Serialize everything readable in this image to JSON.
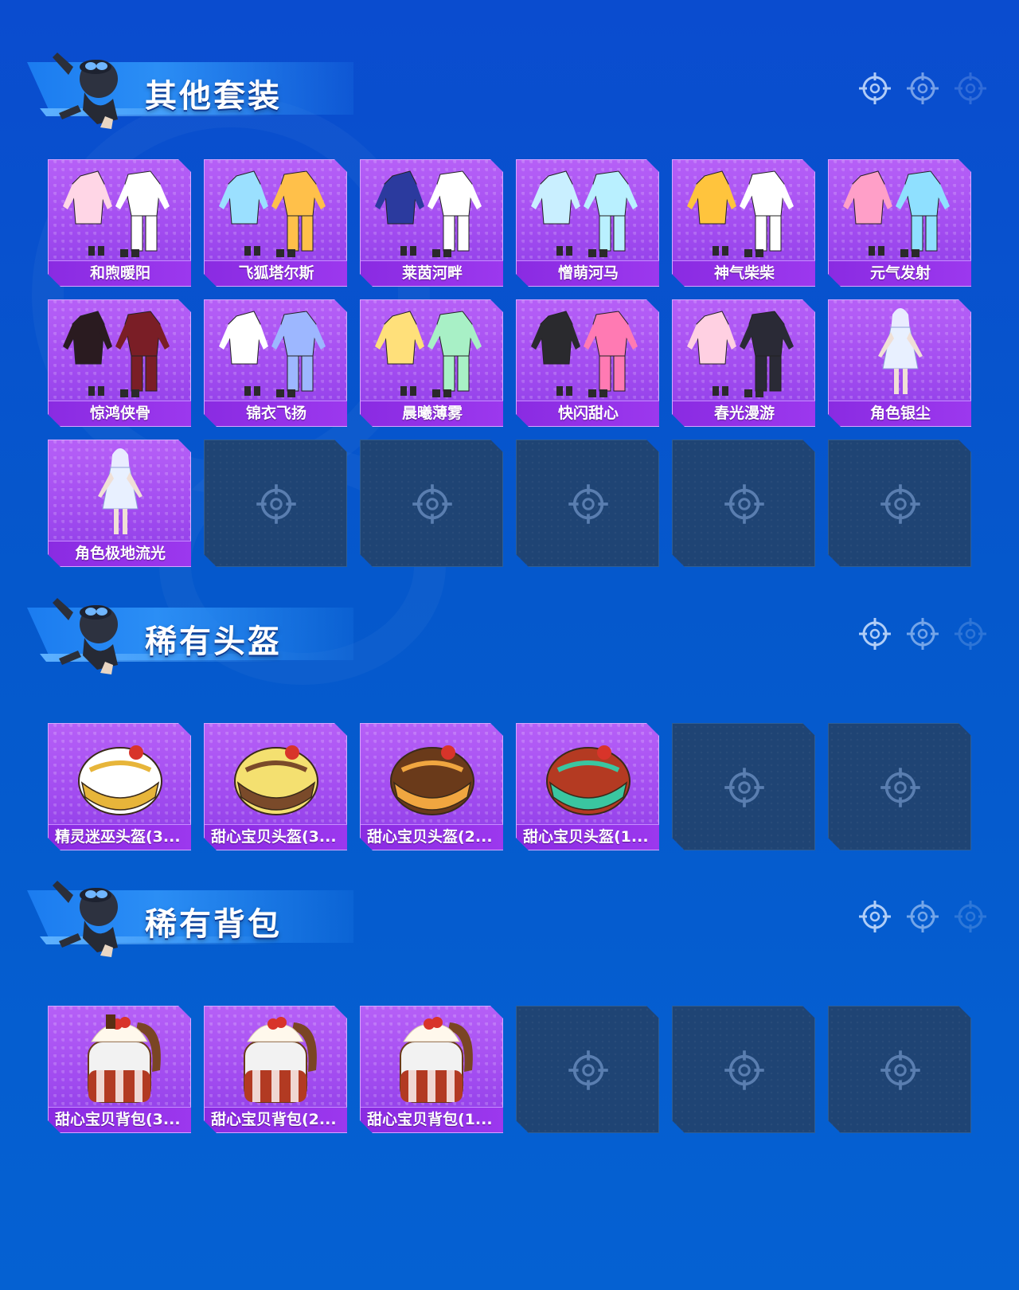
{
  "colors": {
    "background": "#0558cc",
    "card_purple": "#a24cf0",
    "card_label": "#8a2be2",
    "card_empty": "#1f4474",
    "banner": "#2b8ef5"
  },
  "sections": [
    {
      "title": "其他套装",
      "items": [
        {
          "name": "和煦暖阳",
          "icon": "outfit-icon"
        },
        {
          "name": "飞狐塔尔斯",
          "icon": "outfit-icon"
        },
        {
          "name": "莱茵河畔",
          "icon": "outfit-icon"
        },
        {
          "name": "憎萌河马",
          "icon": "outfit-icon"
        },
        {
          "name": "神气柴柴",
          "icon": "outfit-icon"
        },
        {
          "name": "元气发射",
          "icon": "outfit-icon"
        },
        {
          "name": "惊鸿侠骨",
          "icon": "outfit-icon"
        },
        {
          "name": "锦衣飞扬",
          "icon": "outfit-icon"
        },
        {
          "name": "晨曦薄雾",
          "icon": "outfit-icon"
        },
        {
          "name": "快闪甜心",
          "icon": "outfit-icon"
        },
        {
          "name": "春光漫游",
          "icon": "outfit-icon"
        },
        {
          "name": "角色银尘",
          "icon": "character-icon"
        },
        {
          "name": "角色极地流光",
          "icon": "character-icon"
        }
      ],
      "empty_slots": 5
    },
    {
      "title": "稀有头盔",
      "items": [
        {
          "name": "精灵迷巫头盔(3...",
          "icon": "helmet-icon"
        },
        {
          "name": "甜心宝贝头盔(3...",
          "icon": "helmet-icon"
        },
        {
          "name": "甜心宝贝头盔(2...",
          "icon": "helmet-icon"
        },
        {
          "name": "甜心宝贝头盔(1...",
          "icon": "helmet-icon"
        }
      ],
      "empty_slots": 2
    },
    {
      "title": "稀有背包",
      "items": [
        {
          "name": "甜心宝贝背包(3...",
          "icon": "backpack-icon"
        },
        {
          "name": "甜心宝贝背包(2...",
          "icon": "backpack-icon"
        },
        {
          "name": "甜心宝贝背包(1...",
          "icon": "backpack-icon"
        }
      ],
      "empty_slots": 3
    }
  ]
}
